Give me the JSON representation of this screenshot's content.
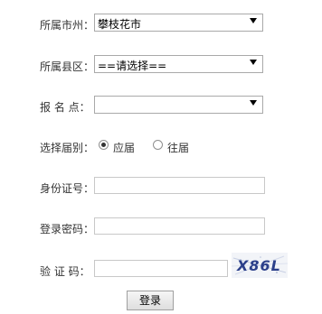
{
  "form": {
    "city": {
      "label": "所属市州：",
      "selected": "攀枝花市"
    },
    "county": {
      "label": "所属县区：",
      "selected": "==请选择=="
    },
    "site": {
      "label": "报 名 点：",
      "selected": ""
    },
    "session": {
      "label": "选择届别：",
      "options": [
        {
          "label": "应届",
          "checked": true
        },
        {
          "label": "往届",
          "checked": false
        }
      ]
    },
    "id_number": {
      "label": "身份证号：",
      "value": ""
    },
    "password": {
      "label": "登录密码：",
      "value": ""
    },
    "captcha": {
      "label": "验 证 码：",
      "value": "",
      "image_text": "X86L"
    },
    "login_label": "登录"
  }
}
